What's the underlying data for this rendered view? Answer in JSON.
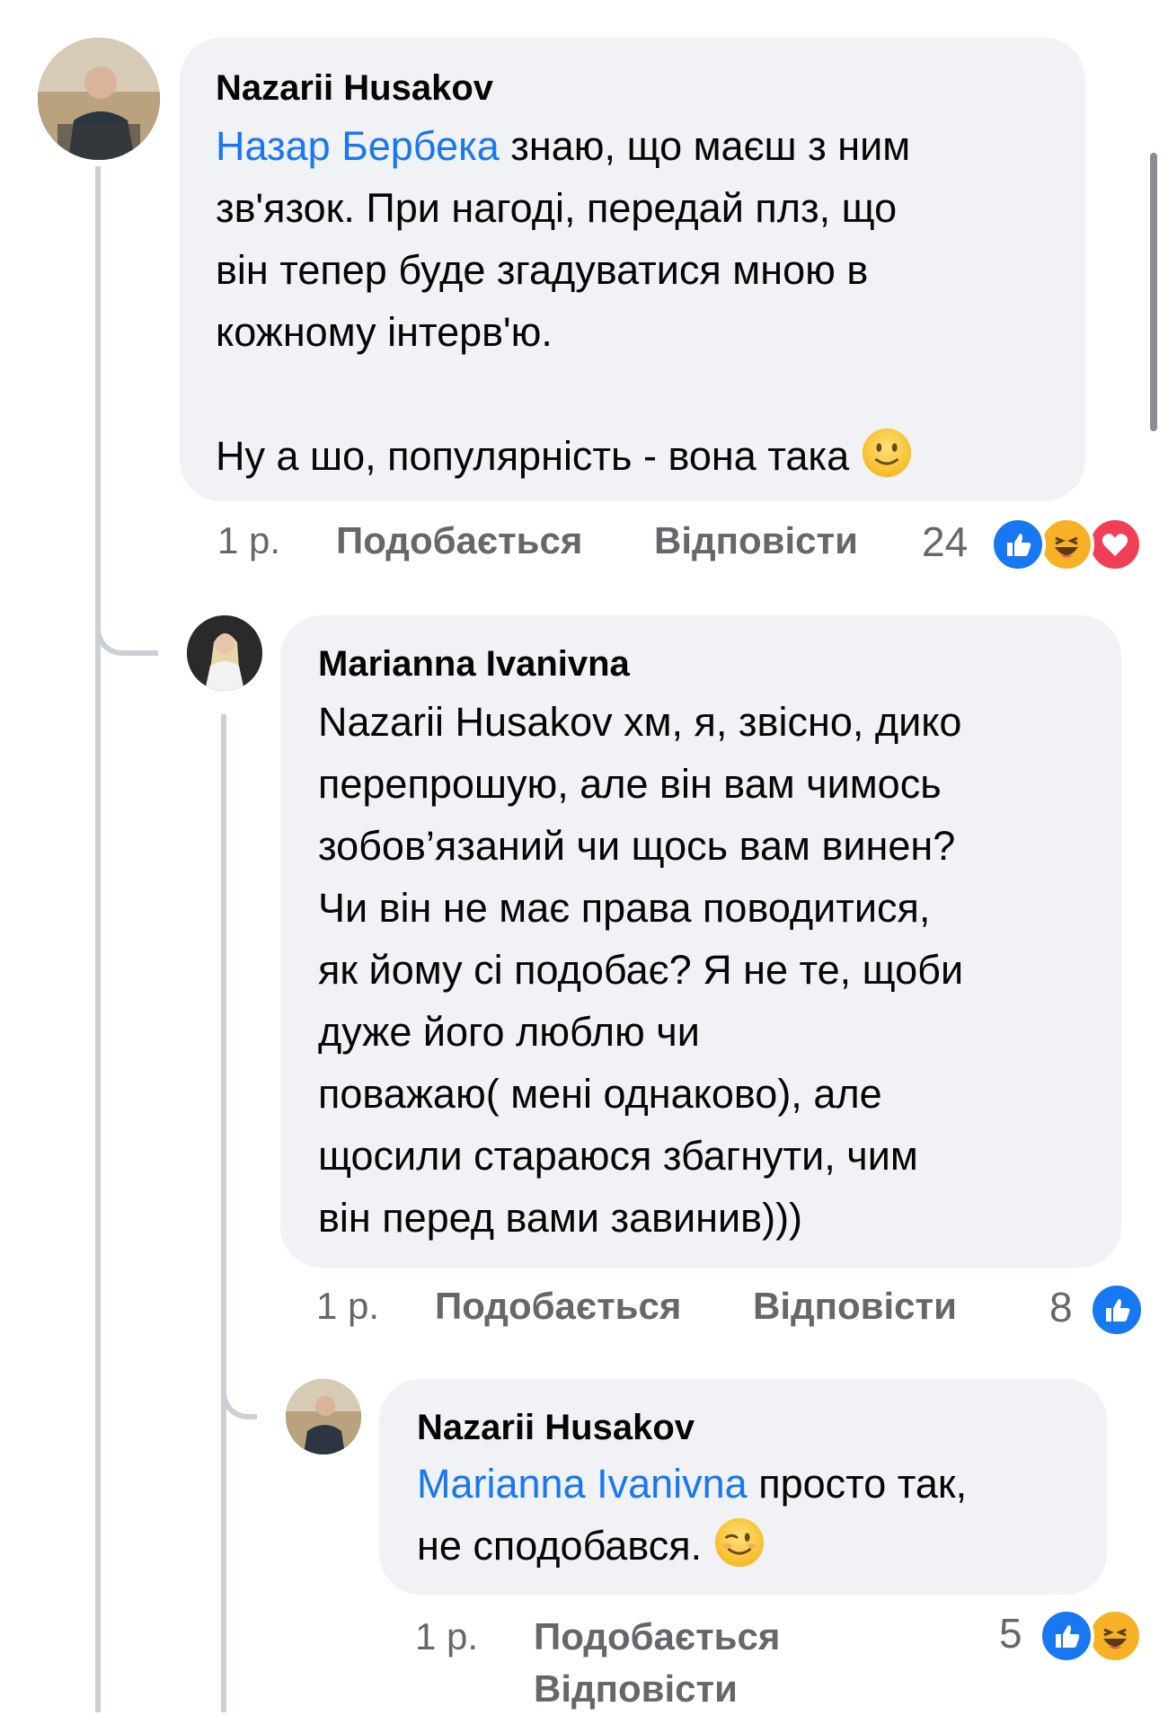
{
  "comments": [
    {
      "author": "Nazarii Husakov",
      "mention": "Назар Бербека",
      "body": " знаю, що маєш з ним\nзв'язок. При нагоді, передай плз, що\nвін тепер буде згадуватися мною в\nкожному інтерв'ю.\n\nНу а шо, популярність - вона така ",
      "emoji": "slightly-smiling-face-emoji",
      "time": "1 р.",
      "like_label": "Подобається",
      "reply_label": "Відповісти",
      "reaction_count": "24",
      "reactions": [
        "like-reaction-icon",
        "haha-reaction-icon",
        "love-reaction-icon"
      ]
    },
    {
      "author": "Marianna Ivanivna",
      "body": "Nazarii Husakov хм, я, звісно, дико\nперепрошую, але він вам чимось\nзобов’язаний чи щось вам винен?\nЧи він не має права поводитися,\nяк йому сі подобає? Я не те, щоби\nдуже його люблю чи\nповажаю( мені однаково), але\nщосили стараюся збагнути, чим\nвін перед вами завинив)))",
      "time": "1 р.",
      "like_label": "Подобається",
      "reply_label": "Відповісти",
      "reaction_count": "8",
      "reactions": [
        "like-reaction-icon"
      ]
    },
    {
      "author": "Nazarii Husakov",
      "mention": "Marianna Ivanivna",
      "body_line1": " просто так,",
      "body_line2": "не сподобався. ",
      "emoji": "winking-face-emoji",
      "time": "1 р.",
      "like_label": "Подобається",
      "reply_label": "Відповісти",
      "reaction_count": "5",
      "reactions": [
        "like-reaction-icon",
        "haha-reaction-icon"
      ]
    }
  ],
  "colors": {
    "mention": "#1877f2",
    "bubble": "#f0f2f5",
    "meta": "#65676b",
    "like": "#1877f2",
    "love": "#f33e58",
    "haha": "#f7b125"
  }
}
